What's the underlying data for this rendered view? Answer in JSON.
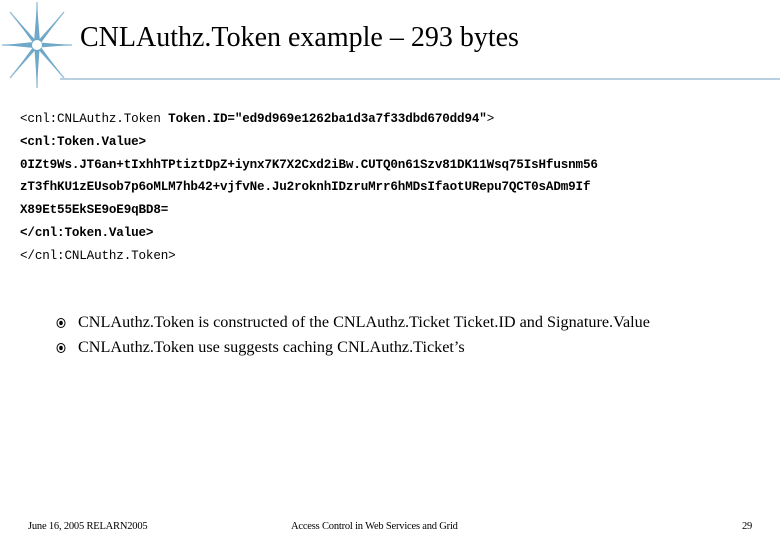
{
  "slide": {
    "title": "CNLAuthz.Token example – 293 bytes"
  },
  "code": {
    "line1_tag": "<cnl:CNLAuthz.Token ",
    "line1_attr": "Token.ID=\"ed9d969e1262ba1d3a7f33dbd670dd94\"",
    "line1_end": ">",
    "line2": "<cnl:Token.Value>",
    "line3": "0IZt9Ws.JT6an+tIxhhTPtiztDpZ+iynx7K7X2Cxd2iBw.CUTQ0n61Szv81DK11Wsq75IsHfusnm56",
    "line4": "zT3fhKU1zEUsob7p6oMLM7hb42+vjfvNe.Ju2roknhIDzruMrr6hMDsIfaotURepu7QCT0sADm9If",
    "line5": "X89Et55EkSE9oE9qBD8=",
    "line6": "</cnl:Token.Value>",
    "line7": "</cnl:CNLAuthz.Token>"
  },
  "bullets": [
    {
      "text": "CNLAuthz.Token is constructed of the CNLAuthz.Ticket Ticket.ID and Signature.Value"
    },
    {
      "text": "CNLAuthz.Token use suggests caching CNLAuthz.Ticket’s"
    }
  ],
  "footer": {
    "left": "June 16, 2005 RELARN2005",
    "center": "Access Control in Web Services and Grid",
    "page_number": "29"
  },
  "colors": {
    "accent_rule": "#b8d0e0",
    "star": "#6fa8c8"
  },
  "icons": {
    "logo": "star-burst-icon",
    "bullet": "bullet-disc-icon"
  }
}
